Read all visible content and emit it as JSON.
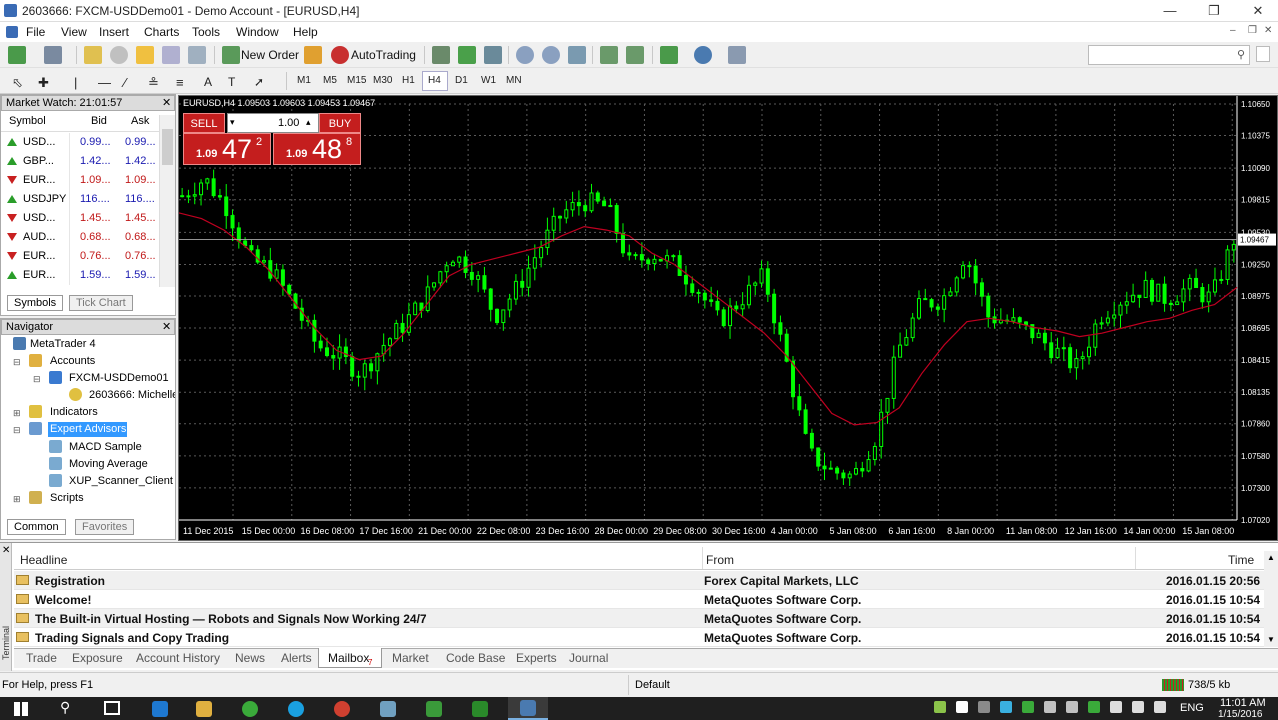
{
  "window": {
    "title": "2603666: FXCM-USDDemo01 - Demo Account - [EURUSD,H4]"
  },
  "menu": [
    "File",
    "View",
    "Insert",
    "Charts",
    "Tools",
    "Window",
    "Help"
  ],
  "toolbar": {
    "new_order": "New Order",
    "autotrading": "AutoTrading"
  },
  "timeframes": [
    "M1",
    "M5",
    "M15",
    "M30",
    "H1",
    "H4",
    "D1",
    "W1",
    "MN"
  ],
  "market_watch": {
    "title": "Market Watch: 21:01:57",
    "headers": [
      "Symbol",
      "Bid",
      "Ask"
    ],
    "rows": [
      {
        "symbol": "USD...",
        "bid": "0.99...",
        "ask": "0.99...",
        "dir": "up"
      },
      {
        "symbol": "GBP...",
        "bid": "1.42...",
        "ask": "1.42...",
        "dir": "up"
      },
      {
        "symbol": "EUR...",
        "bid": "1.09...",
        "ask": "1.09...",
        "dir": "down"
      },
      {
        "symbol": "USDJPY",
        "bid": "116....",
        "ask": "116....",
        "dir": "up"
      },
      {
        "symbol": "USD...",
        "bid": "1.45...",
        "ask": "1.45...",
        "dir": "down"
      },
      {
        "symbol": "AUD...",
        "bid": "0.68...",
        "ask": "0.68...",
        "dir": "down"
      },
      {
        "symbol": "EUR...",
        "bid": "0.76...",
        "ask": "0.76...",
        "dir": "down"
      },
      {
        "symbol": "EUR...",
        "bid": "1.59...",
        "ask": "1.59...",
        "dir": "up"
      }
    ],
    "tabs": [
      "Symbols",
      "Tick Chart"
    ]
  },
  "navigator": {
    "title": "Navigator",
    "items": [
      "MetaTrader 4",
      "Accounts",
      "FXCM-USDDemo01",
      "2603666: Michelle",
      "Indicators",
      "Expert Advisors",
      "MACD Sample",
      "Moving Average",
      "XUP_Scanner_Client",
      "Scripts"
    ],
    "tabs": [
      "Common",
      "Favorites"
    ]
  },
  "chart": {
    "header": "EURUSD,H4  1.09503 1.09603 1.09453 1.09467",
    "sell_label": "SELL",
    "buy_label": "BUY",
    "lot": "1.00",
    "sell_prefix": "1.09",
    "sell_big": "47",
    "sell_sup": "2",
    "buy_prefix": "1.09",
    "buy_big": "48",
    "buy_sup": "8",
    "current_price": "1.09467",
    "up_color": "#00ff00",
    "ma_color": "#c00020",
    "bg_color": "#000000"
  },
  "chart_data": {
    "type": "candlestick",
    "title": "EURUSD,H4",
    "y_ticks": [
      "1.10650",
      "1.10375",
      "1.10090",
      "1.09815",
      "1.09530",
      "1.09250",
      "1.08975",
      "1.08695",
      "1.08415",
      "1.08135",
      "1.07860",
      "1.07580",
      "1.07300",
      "1.07020"
    ],
    "x_ticks": [
      "11 Dec 2015",
      "15 Dec 00:00",
      "16 Dec 08:00",
      "17 Dec 16:00",
      "21 Dec 00:00",
      "22 Dec 08:00",
      "23 Dec 16:00",
      "28 Dec 00:00",
      "29 Dec 08:00",
      "30 Dec 16:00",
      "4 Jan 00:00",
      "5 Jan 08:00",
      "6 Jan 16:00",
      "8 Jan 00:00",
      "11 Jan 08:00",
      "12 Jan 16:00",
      "14 Jan 00:00",
      "15 Jan 08:00"
    ],
    "ylim": [
      1.0702,
      1.1065
    ],
    "approx_close_path": [
      1.0985,
      1.1,
      1.0975,
      1.093,
      1.092,
      1.089,
      1.0855,
      1.0845,
      1.083,
      1.0855,
      1.0875,
      1.09,
      1.0935,
      1.092,
      1.088,
      1.0905,
      1.094,
      1.097,
      1.098,
      1.0975,
      1.0925,
      1.0935,
      1.0925,
      1.0905,
      1.0875,
      1.0895,
      1.0915,
      1.084,
      1.076,
      1.0745,
      1.074,
      1.0775,
      1.085,
      1.089,
      1.0895,
      1.0935,
      1.088,
      1.0875,
      1.0865,
      1.085,
      1.0835,
      1.088,
      1.0895,
      1.0905,
      1.0895,
      1.0905,
      1.0895,
      1.0947
    ],
    "ma_path": [
      1.097,
      1.0965,
      1.0955,
      1.094,
      1.092,
      1.0895,
      1.087,
      1.085,
      1.0842,
      1.0845,
      1.0865,
      1.089,
      1.0915,
      1.0925,
      1.093,
      1.0935,
      1.094,
      1.095,
      1.0958,
      1.0955,
      1.095,
      1.0935,
      1.0925,
      1.091,
      1.0895,
      1.088,
      1.0865,
      1.0845,
      1.082,
      1.0795,
      1.0785,
      1.0787,
      1.08,
      1.083,
      1.0855,
      1.0875,
      1.0878,
      1.0875,
      1.087,
      1.0867,
      1.0862,
      1.0865,
      1.087,
      1.0875,
      1.0878,
      1.0885,
      1.089,
      1.0905
    ]
  },
  "terminal": {
    "headers": {
      "headline": "Headline",
      "from": "From",
      "time": "Time"
    },
    "rows": [
      {
        "headline": "Registration",
        "from": "Forex Capital Markets, LLC",
        "time": "2016.01.15 20:56"
      },
      {
        "headline": "Welcome!",
        "from": "MetaQuotes Software Corp.",
        "time": "2016.01.15 10:54"
      },
      {
        "headline": "The Built-in Virtual Hosting — Robots and Signals Now Working 24/7",
        "from": "MetaQuotes Software Corp.",
        "time": "2016.01.15 10:54"
      },
      {
        "headline": "Trading Signals and Copy Trading",
        "from": "MetaQuotes Software Corp.",
        "time": "2016.01.15 10:54"
      }
    ],
    "tabs": [
      "Trade",
      "Exposure",
      "Account History",
      "News",
      "Alerts",
      "Mailbox",
      "Market",
      "Code Base",
      "Experts",
      "Journal"
    ],
    "mailbox_badge": "7",
    "side_label": "Terminal"
  },
  "status": {
    "help": "For Help, press F1",
    "profile": "Default",
    "traffic": "738/5 kb"
  },
  "taskbar": {
    "time": "11:01 AM",
    "date": "1/15/2016",
    "lang": "ENG"
  }
}
